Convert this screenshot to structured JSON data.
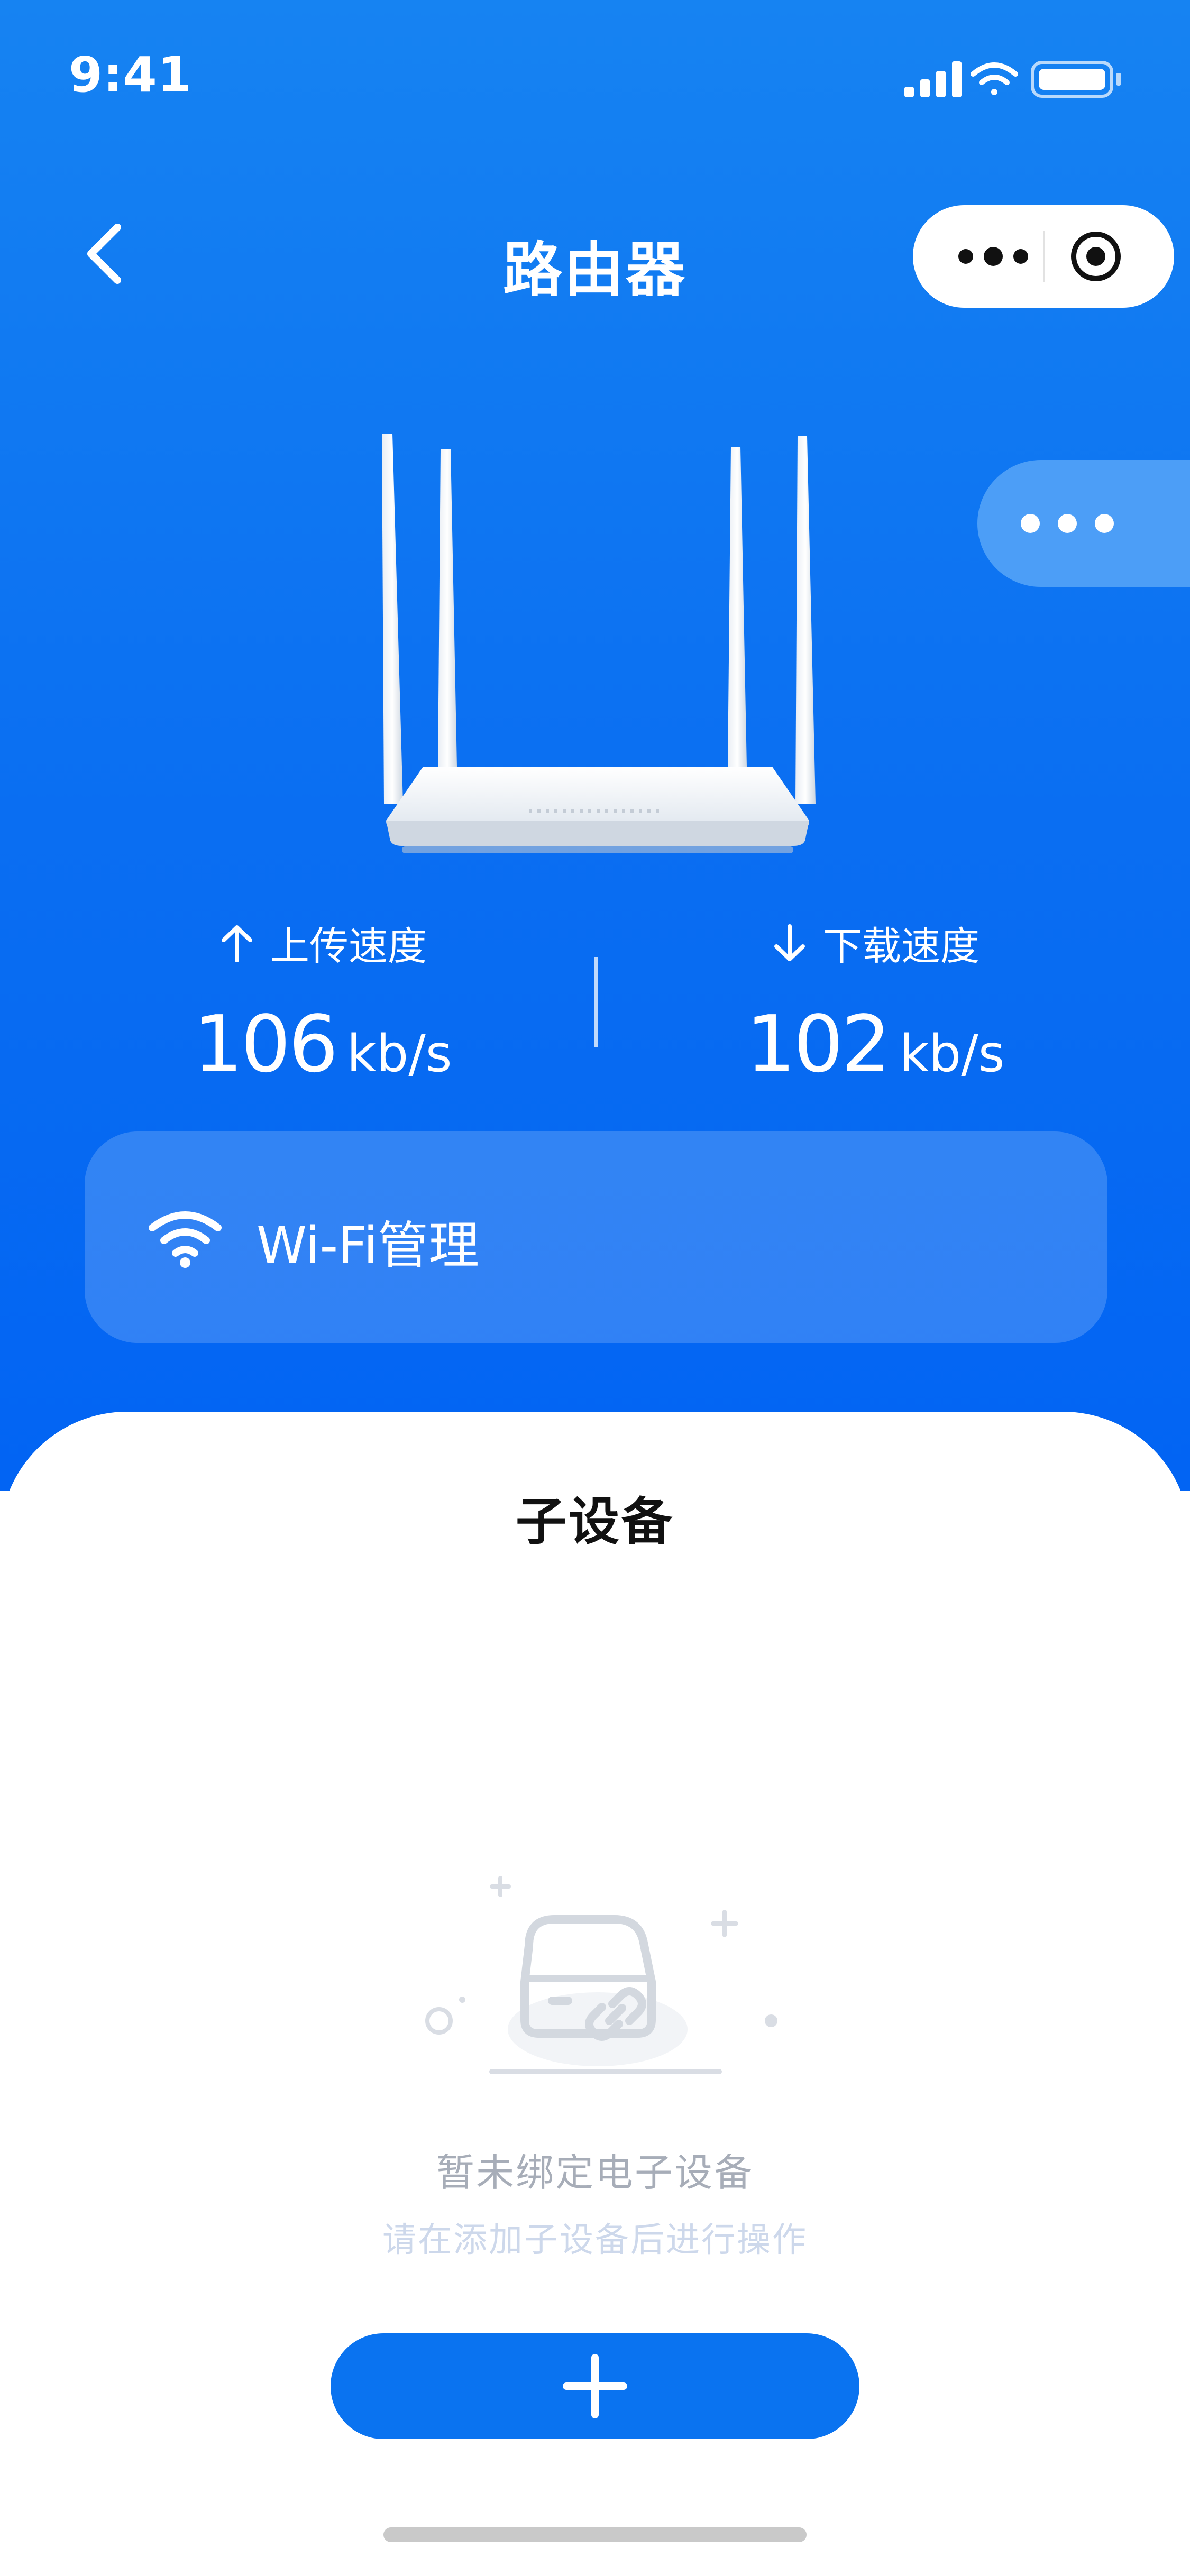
{
  "status_bar": {
    "time": "9:41"
  },
  "nav": {
    "title": "路由器",
    "back_icon": "chevron-left-icon",
    "more_icon": "more-dots-icon",
    "target_icon": "target-icon"
  },
  "floating_menu_icon": "more-dots-icon",
  "device_image": "router",
  "speed": {
    "upload": {
      "label": "上传速度",
      "value": "106",
      "unit": "kb/s",
      "icon": "arrow-up-icon"
    },
    "download": {
      "label": "下载速度",
      "value": "102",
      "unit": "kb/s",
      "icon": "arrow-down-icon"
    }
  },
  "wifi_card": {
    "label": "Wi-Fi管理",
    "icon": "wifi-icon"
  },
  "sub_devices": {
    "title": "子设备",
    "empty_title": "暂未绑定电子设备",
    "empty_subtitle": "请在添加子设备后进行操作",
    "add_icon": "plus-icon"
  },
  "colors": {
    "hero_top": "#1683f2",
    "hero_bottom": "#0264f3",
    "accent": "#0a73f0",
    "empty_title": "#a7adb8",
    "empty_subtitle": "#cdd8eb"
  }
}
